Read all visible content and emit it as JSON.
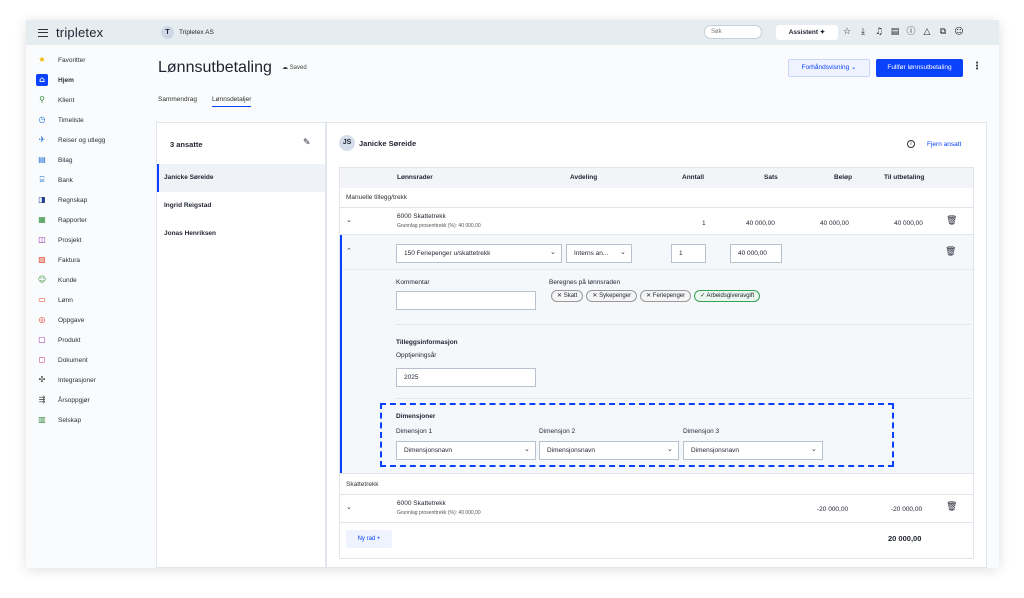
{
  "app": {
    "logo": "tripletex",
    "company_initial": "T",
    "company_name": "Tripletex AS"
  },
  "topbar": {
    "search_placeholder": "Søk",
    "assistant_label": "Assistent ✦"
  },
  "sidebar": {
    "items": [
      {
        "label": "Favoritter",
        "icon": "★"
      },
      {
        "label": "Hjem",
        "icon": "⌂"
      },
      {
        "label": "Klient",
        "icon": "⚲"
      },
      {
        "label": "Timeliste",
        "icon": "◷"
      },
      {
        "label": "Reiser og utlegg",
        "icon": "✈"
      },
      {
        "label": "Bilag",
        "icon": "▤"
      },
      {
        "label": "Bank",
        "icon": "⌸"
      },
      {
        "label": "Regnskap",
        "icon": "◨"
      },
      {
        "label": "Rapporter",
        "icon": "▦"
      },
      {
        "label": "Prosjekt",
        "icon": "◫"
      },
      {
        "label": "Faktura",
        "icon": "▧"
      },
      {
        "label": "Kunde",
        "icon": "☺"
      },
      {
        "label": "Lønn",
        "icon": "▭"
      },
      {
        "label": "Oppgave",
        "icon": "◎"
      },
      {
        "label": "Produkt",
        "icon": "▢"
      },
      {
        "label": "Dokument",
        "icon": "◻"
      },
      {
        "label": "Integrasjoner",
        "icon": "✣"
      },
      {
        "label": "Årsoppgjør",
        "icon": "⇶"
      },
      {
        "label": "Selskap",
        "icon": "▥"
      }
    ]
  },
  "header": {
    "title": "Lønnsutbetaling",
    "saved": "☁ Saved",
    "preview_label": "Forhåndsvisning  ⌄",
    "finish_label": "Fullfør lønnsutbetaling"
  },
  "tabs": [
    "Sammendrag",
    "Lønnsdetaljer"
  ],
  "employees": {
    "heading": "3 ansatte",
    "list": [
      "Janicke Søreide",
      "Ingrid Reigstad",
      "Jonas Henriksen"
    ]
  },
  "detail": {
    "initials": "JS",
    "name": "Janicke Søreide",
    "remove_label": "Fjern ansatt",
    "columns": [
      "Lønnsrader",
      "Avdeling",
      "Anntall",
      "Sats",
      "Beløp",
      "Til utbetaling"
    ],
    "manual_section": "Manuelle tillegg/trekk",
    "row1": {
      "title": "6000 Skattetrekk",
      "sub": "Grunnlag prosenttrekk (%): 40 000,00",
      "antall": "1",
      "sats": "40 000,00",
      "belop": "40 000,00",
      "til": "40 000,00"
    },
    "edit": {
      "wage_type": "150 Feriepenger u/skattetrekk",
      "department": "Interns an...",
      "antall": "1",
      "sats": "40 000,00",
      "comment_label": "Kommentar",
      "calc_label": "Beregnes på lønnsraden",
      "chips": [
        "✕ Skatt",
        "✕ Sykepenger",
        "✕ Feriepenger",
        "✓ Arbeidsgiveravgift"
      ],
      "extra_heading": "Tilleggsinformasjon",
      "earn_year_label": "Opptjeningsår",
      "earn_year_value": "2025",
      "dim_heading": "Dimensjoner",
      "dims": [
        {
          "label": "Dimensjon 1",
          "value": "Dimensjonsnavn"
        },
        {
          "label": "Dimensjon 2",
          "value": "Dimensjonsnavn"
        },
        {
          "label": "Dimensjon 3",
          "value": "Dimensjonsnavn"
        }
      ]
    },
    "tax_section": "Skattetrekk",
    "row2": {
      "title": "6000 Skattetrekk",
      "sub": "Grunnlag prosenttrekk (%): 40 000,00",
      "belop": "-20 000,00",
      "til": "-20 000,00"
    },
    "new_row_label": "Ny rad  +",
    "total": "20 000,00"
  },
  "colors": {
    "accent": "#0a41fa"
  }
}
